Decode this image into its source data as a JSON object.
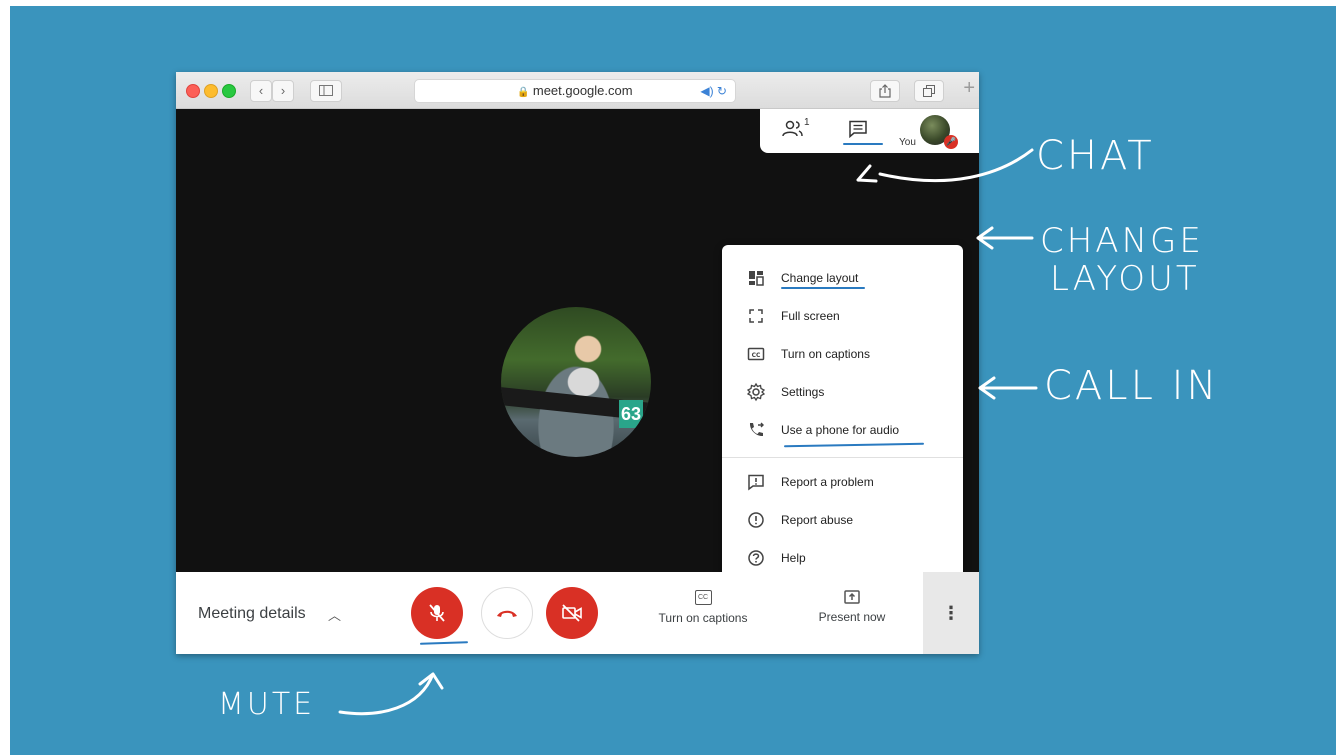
{
  "browser": {
    "url": "meet.google.com",
    "back_label": "‹",
    "forward_label": "›",
    "new_tab_label": "+"
  },
  "topbar": {
    "participants_count": "1",
    "you_label": "You"
  },
  "participant": {
    "bib_number": "63"
  },
  "menu": {
    "items": [
      {
        "label": "Change layout",
        "icon": "layout-icon"
      },
      {
        "label": "Full screen",
        "icon": "fullscreen-icon"
      },
      {
        "label": "Turn on captions",
        "icon": "captions-icon"
      },
      {
        "label": "Settings",
        "icon": "gear-icon"
      },
      {
        "label": "Use a phone for audio",
        "icon": "phone-icon"
      },
      {
        "label": "Report a problem",
        "icon": "feedback-icon"
      },
      {
        "label": "Report abuse",
        "icon": "alert-icon"
      },
      {
        "label": "Help",
        "icon": "help-icon"
      }
    ]
  },
  "bottombar": {
    "meeting_details": "Meeting details",
    "captions_label": "Turn on captions",
    "captions_icon": "CC",
    "present_label": "Present now",
    "more_label": "⋮"
  },
  "annotations": {
    "chat": "CHAT",
    "change_line1": "CHANGE",
    "change_line2": "LAYOUT",
    "call_in": "CALL IN",
    "mute": "MUTE"
  },
  "colors": {
    "background": "#3a94bd",
    "danger": "#d93025",
    "underline": "#2a7ac0"
  }
}
